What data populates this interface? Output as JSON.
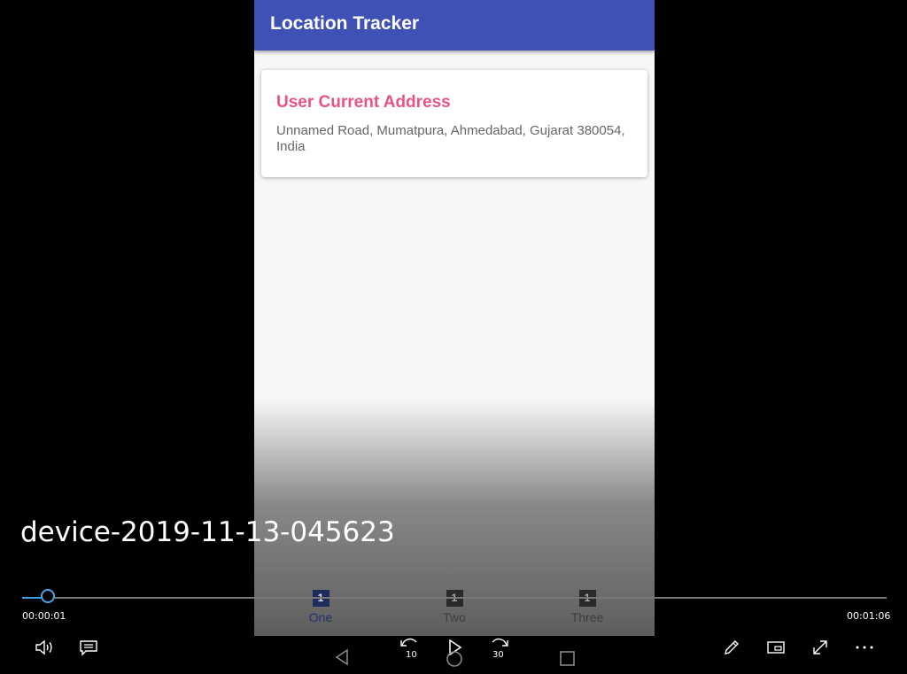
{
  "app": {
    "title": "Location Tracker",
    "card": {
      "title": "User Current Address",
      "address": "Unnamed Road, Mumatpura, Ahmedabad, Gujarat 380054, India"
    },
    "tabs": [
      {
        "label": "One",
        "badge": "1",
        "active": true
      },
      {
        "label": "Two",
        "badge": "1",
        "active": false
      },
      {
        "label": "Three",
        "badge": "1",
        "active": false
      }
    ],
    "accent_colors": {
      "appbar": "#3f51b5",
      "card_title": "#e95383"
    }
  },
  "player": {
    "video_title": "device-2019-11-13-045623",
    "current_time": "00:00:01",
    "total_time": "00:01:06",
    "progress_fraction": 0.03,
    "rewind_seconds": "10",
    "forward_seconds": "30",
    "controls": [
      "volume-icon",
      "captions-icon",
      "rewind-10-icon",
      "play-icon",
      "forward-30-icon",
      "pen-icon",
      "mini-view-icon",
      "fullscreen-icon",
      "more-icon"
    ]
  },
  "android_nav": [
    "back-icon",
    "home-icon",
    "recents-icon"
  ]
}
